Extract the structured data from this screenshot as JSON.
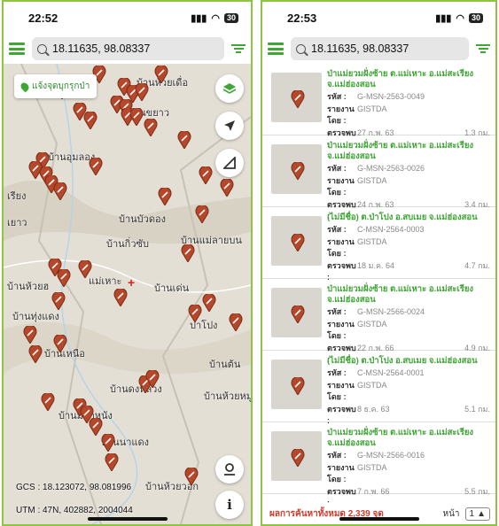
{
  "left": {
    "status": {
      "time": "22:52",
      "signal": "▮▮▮",
      "wifi": "◠",
      "battery": "30"
    },
    "search": {
      "value": "18.11635, 98.08337"
    },
    "report_button": "แจ้งจุดบุกรุกป่า",
    "map_labels": [
      "บ้านห้วยเดื่อ",
      "บ้านขยาว",
      "บ้านอุมลอง",
      "เรียง",
      "เยาว",
      "บ้านบัวดอง",
      "บ้านกิ่วซับ",
      "บ้านแม่ลายบน",
      "บ้านห้วยฮ",
      "แม่เหาะ",
      "บ้านเด่น",
      "บ้านทุ่งแดง",
      "ปาโปง",
      "บ้านเหนือ",
      "บ้านต้น",
      "บ้านดงหลวง",
      "บ้านห้วยหมู",
      "บ้านมากหนัง",
      "บ้านนาแดง",
      "บ้านห้วยวอก"
    ],
    "gcs": "GCS : 18.123072, 98.081996",
    "utm": "UTM : 47N, 402882, 2004044"
  },
  "right": {
    "status": {
      "time": "22:53",
      "signal": "▮▮▮",
      "wifi": "◠",
      "battery": "30"
    },
    "search": {
      "value": "18.11635, 98.08337"
    },
    "labels": {
      "code": "รหัส :",
      "reporter": "รายงานโดย :",
      "found": "ตรวจพบ :"
    },
    "items": [
      {
        "title": "ป่าแม่ยวมฝั่งซ้าย ต.แม่เหาะ อ.แม่สะเรียง จ.แม่ฮ่องสอน",
        "code": "G-MSN-2563-0049",
        "reporter": "GISTDA",
        "date": "27 ก.พ. 63",
        "dist": "1.3 กม."
      },
      {
        "title": "ป่าแม่ยวมฝั่งซ้าย ต.แม่เหาะ อ.แม่สะเรียง จ.แม่ฮ่องสอน",
        "code": "G-MSN-2563-0026",
        "reporter": "GISTDA",
        "date": "24 ก.พ. 63",
        "dist": "3.4 กม."
      },
      {
        "title": "(ไม่มีชื่อ) ต.ป่าโปง อ.สบเมย จ.แม่ฮ่องสอน",
        "code": "C-MSN-2564-0003",
        "reporter": "GISTDA",
        "date": "18 ม.ค. 64",
        "dist": "4.7 กม."
      },
      {
        "title": "ป่าแม่ยวมฝั่งซ้าย ต.แม่เหาะ อ.แม่สะเรียง จ.แม่ฮ่องสอน",
        "code": "G-MSN-2566-0024",
        "reporter": "GISTDA",
        "date": "22 ก.พ. 66",
        "dist": "4.9 กม."
      },
      {
        "title": "(ไม่มีชื่อ) ต.ป่าโปง อ.สบเมย จ.แม่ฮ่องสอน",
        "code": "C-MSN-2564-0001",
        "reporter": "GISTDA",
        "date": "8 ธ.ค. 63",
        "dist": "5.1 กม."
      },
      {
        "title": "ป่าแม่ยวมฝั่งซ้าย ต.แม่เหาะ อ.แม่สะเรียง จ.แม่ฮ่องสอน",
        "code": "G-MSN-2566-0016",
        "reporter": "GISTDA",
        "date": "7 ก.พ. 66",
        "dist": "5.5 กม."
      }
    ],
    "footer": {
      "total": "ผลการค้นหาทั้งหมด 2,339 จุด",
      "page_label": "หน้า",
      "page": "1"
    }
  }
}
